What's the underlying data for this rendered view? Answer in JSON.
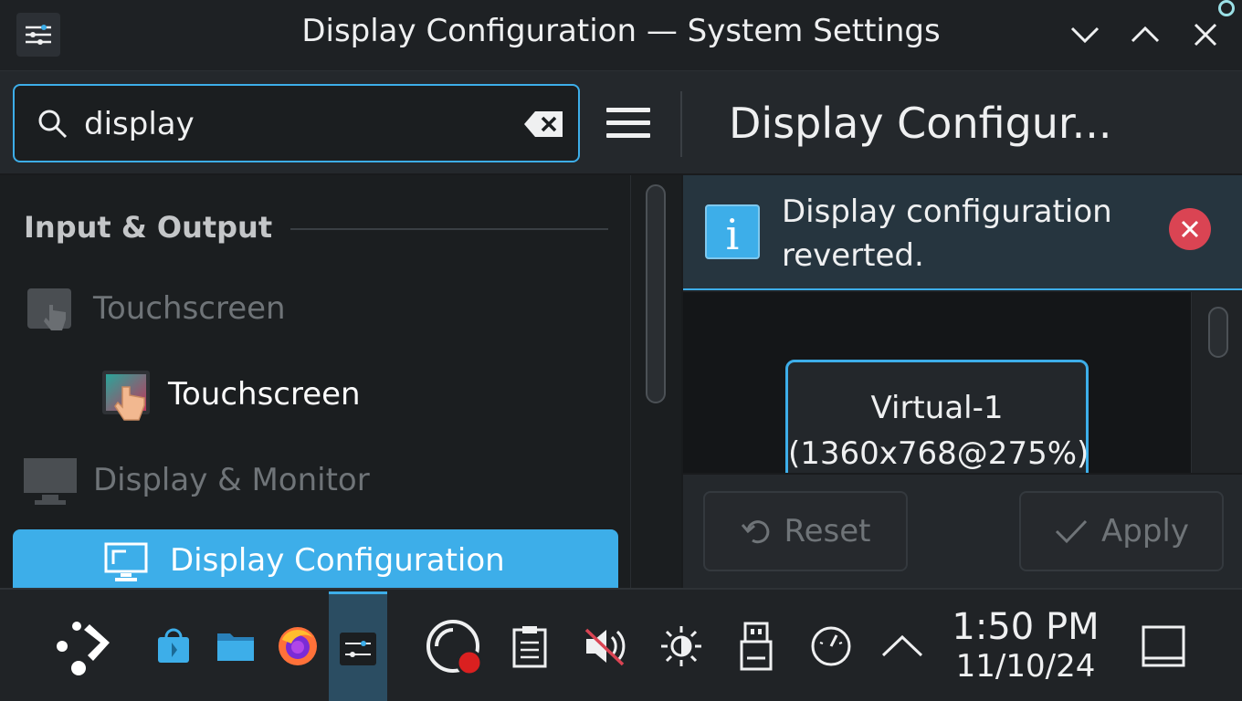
{
  "window": {
    "title": "Display Configuration — System Settings"
  },
  "header": {
    "search_value": "display",
    "page_title": "Display Configur..."
  },
  "sidebar": {
    "section_title": "Input & Output",
    "items": [
      {
        "label": "Touchscreen",
        "kind": "category",
        "icon": "touchscreen-category-icon"
      },
      {
        "label": "Touchscreen",
        "kind": "module",
        "icon": "touchscreen-icon"
      },
      {
        "label": "Display & Monitor",
        "kind": "category",
        "icon": "monitor-category-icon"
      },
      {
        "label": "Display Configuration",
        "kind": "module",
        "icon": "display-configuration-icon",
        "selected": true
      }
    ]
  },
  "main": {
    "banner_text": "Display configuration reverted.",
    "monitor_name": "Virtual-1",
    "monitor_resolution": "(1360x768@275%)",
    "reset_label": "Reset",
    "apply_label": "Apply"
  },
  "taskbar": {
    "apps": [
      "application-launcher-icon",
      "discover-store-icon",
      "file-manager-icon",
      "firefox-icon",
      "system-settings-icon"
    ],
    "tray": [
      "screen-recorder-icon",
      "clipboard-icon",
      "volume-muted-icon",
      "brightness-icon",
      "usb-drive-icon",
      "performance-gauge-icon",
      "expand-tray-icon"
    ],
    "time": "1:50 PM",
    "date": "11/10/24"
  },
  "colors": {
    "accent": "#3daee9",
    "close_red": "#da4453",
    "background": "#202326"
  }
}
